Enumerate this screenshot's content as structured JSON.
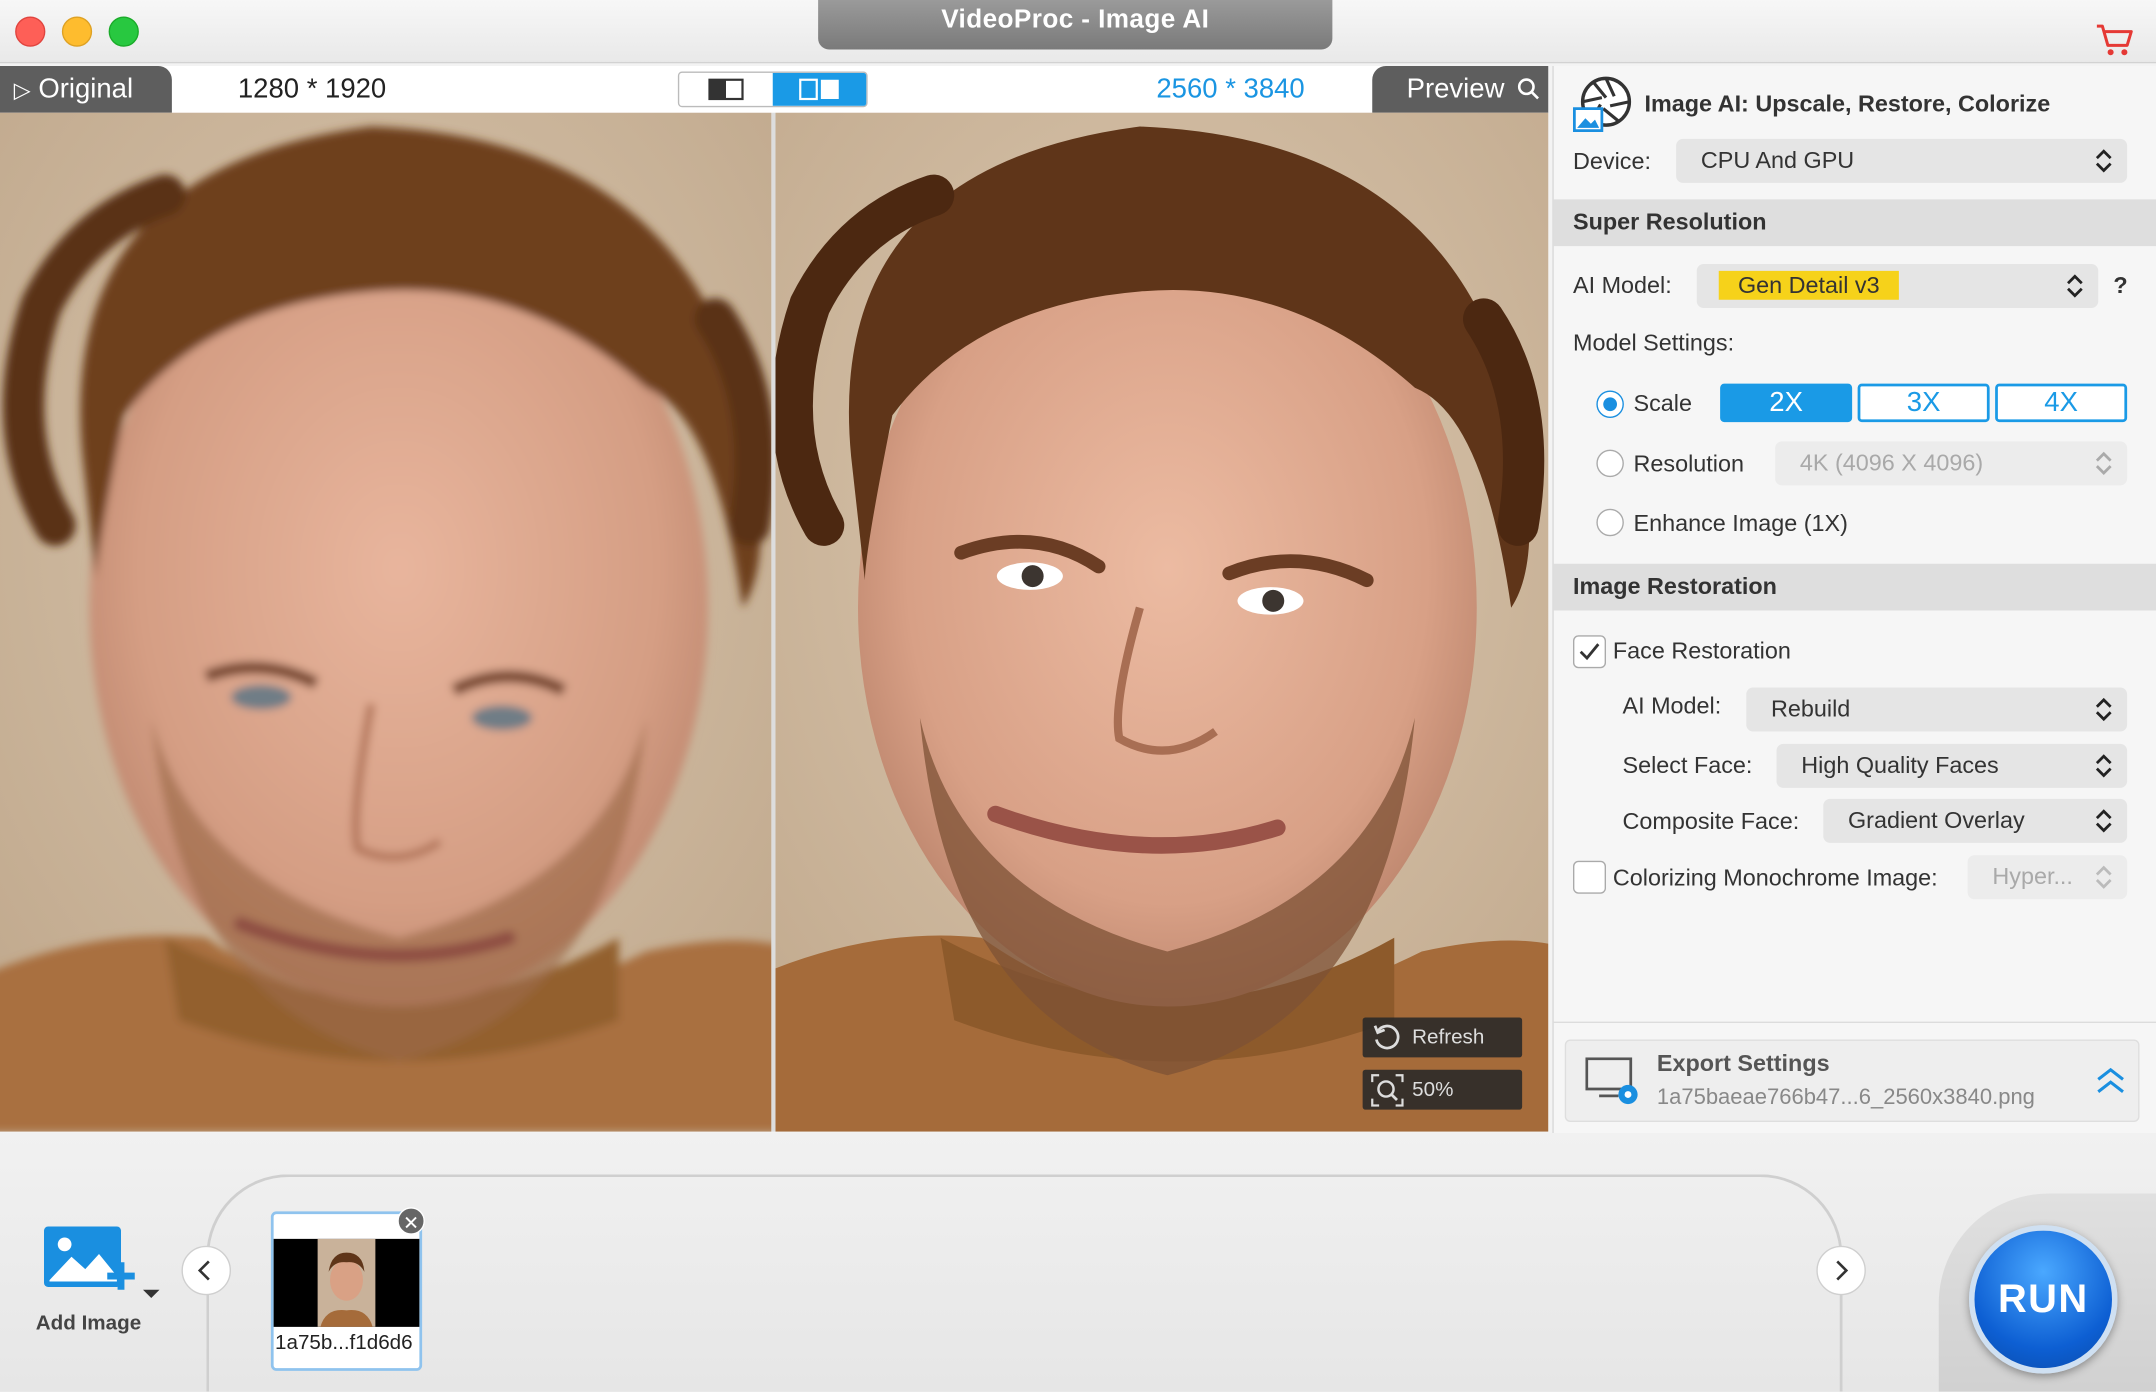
{
  "app": {
    "title": "VideoProc - Image AI"
  },
  "viewer": {
    "original_tab": "Original",
    "original_resolution": "1280 * 1920",
    "preview_tab": "Preview",
    "preview_resolution": "2560 * 3840",
    "refresh_label": "Refresh",
    "zoom_label": "50%",
    "view_mode": "split"
  },
  "panel": {
    "header_title": "Image AI: Upscale, Restore, Colorize",
    "device_label": "Device:",
    "device_value": "CPU And GPU",
    "super_resolution": {
      "title": "Super Resolution",
      "ai_model_label": "AI Model:",
      "ai_model_value": "Gen Detail v3",
      "help": "?",
      "model_settings_label": "Model Settings:",
      "scale_label": "Scale",
      "scale_options": [
        "2X",
        "3X",
        "4X"
      ],
      "scale_selected": "2X",
      "resolution_label": "Resolution",
      "resolution_value": "4K (4096 X 4096)",
      "enhance_label": "Enhance Image (1X)"
    },
    "image_restoration": {
      "title": "Image Restoration",
      "face_restoration_label": "Face Restoration",
      "face_restoration_checked": true,
      "ai_model_label": "AI Model:",
      "ai_model_value": "Rebuild",
      "select_face_label": "Select Face:",
      "select_face_value": "High Quality Faces",
      "composite_face_label": "Composite Face:",
      "composite_face_value": "Gradient Overlay",
      "colorizing_label": "Colorizing Monochrome Image:",
      "colorizing_checked": false,
      "colorizing_value": "Hyper..."
    },
    "export": {
      "title": "Export Settings",
      "filename": "1a75baeae766b47...6_2560x3840.png"
    }
  },
  "bottom": {
    "add_image_label": "Add Image",
    "thumbnail_label": "1a75b...f1d6d6",
    "run_label": "RUN"
  },
  "colors": {
    "accent": "#1a9ae6",
    "highlight": "#f6d21a",
    "run_blue": "#0d5fd3"
  }
}
